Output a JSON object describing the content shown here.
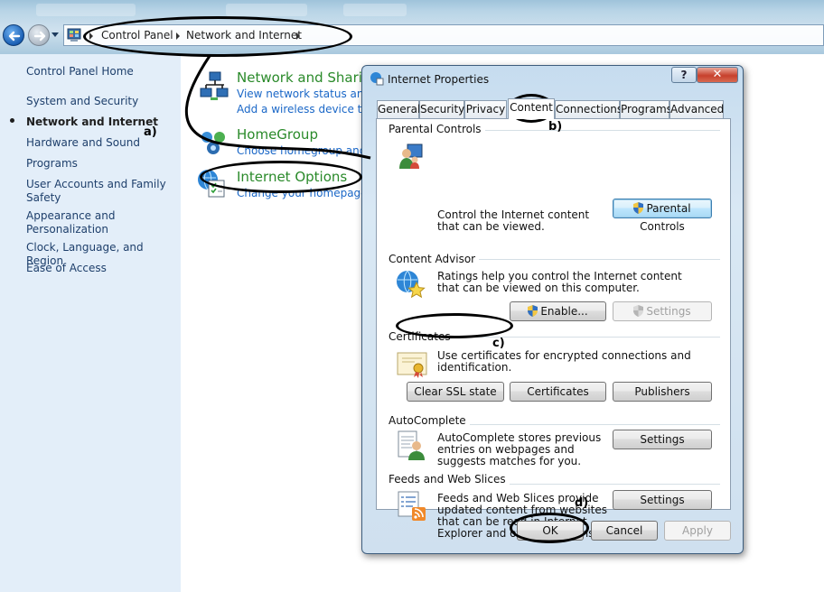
{
  "breadcrumb": {
    "items": [
      "Control Panel",
      "Network and Internet"
    ]
  },
  "left_nav": {
    "home": "Control Panel Home",
    "items": [
      "System and Security",
      "Network and Internet",
      "Hardware and Sound",
      "Programs",
      "User Accounts and Family Safety",
      "Appearance and Personalization",
      "Clock, Language, and Region",
      "Ease of Access"
    ],
    "active_item": "Network and Internet"
  },
  "categories": [
    {
      "title": "Network and Sharin",
      "links": [
        "View network status and ta",
        "Add a wireless device to th"
      ]
    },
    {
      "title": "HomeGroup",
      "links": [
        "Choose homegroup and s"
      ]
    },
    {
      "title": "Internet Options",
      "links": [
        "Change your homepage"
      ]
    }
  ],
  "dialog": {
    "title": "Internet Properties",
    "help_glyph": "?",
    "close_glyph": "✕",
    "tabs": [
      "General",
      "Security",
      "Privacy",
      "Content",
      "Connections",
      "Programs",
      "Advanced"
    ],
    "active_tab": "Content",
    "sections": {
      "parental": {
        "title": "Parental Controls",
        "text": "Control the Internet content that can be viewed.",
        "button": "Parental Controls"
      },
      "advisor": {
        "title": "Content Advisor",
        "text": "Ratings help you control the Internet content that can be viewed on this computer.",
        "enable_button": "Enable...",
        "settings_button": "Settings"
      },
      "certificates": {
        "title": "Certificates",
        "text": "Use certificates for encrypted connections and identification.",
        "clear_ssl_button": "Clear SSL state",
        "certificates_button": "Certificates",
        "publishers_button": "Publishers"
      },
      "autocomplete": {
        "title": "AutoComplete",
        "text": "AutoComplete stores previous entries on webpages and suggests matches for you.",
        "settings_button": "Settings"
      },
      "feeds": {
        "title": "Feeds and Web Slices",
        "text": "Feeds and Web Slices provide updated content from websites that can be read in Internet Explorer and other programs.",
        "settings_button": "Settings"
      }
    },
    "footer": {
      "ok": "OK",
      "cancel": "Cancel",
      "apply": "Apply"
    }
  },
  "annotations": {
    "a": "a)",
    "b": "b)",
    "c": "c)",
    "d": "d)"
  },
  "icons": {
    "back": "back-arrow-icon",
    "forward": "forward-arrow-icon",
    "control_panel": "control-panel-icon",
    "network": "network-icon",
    "homegroup": "homegroup-icon",
    "internet_options": "internet-options-icon",
    "parental": "parental-controls-icon",
    "advisor": "content-advisor-icon",
    "certificate": "certificate-icon",
    "autocomplete": "autocomplete-icon",
    "feeds": "feeds-icon",
    "shield": "uac-shield-icon"
  }
}
